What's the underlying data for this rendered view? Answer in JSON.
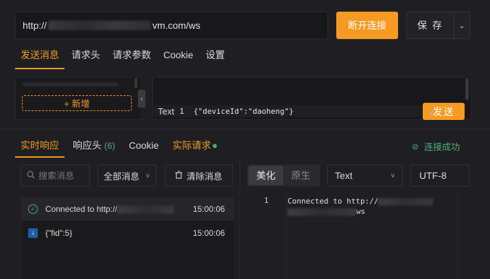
{
  "request": {
    "url_prefix": "http://",
    "url_suffix": "vm.com/ws",
    "disconnect_label": "断开连接",
    "save_label": "保 存",
    "save_dropdown_icon": "chevron-down-icon",
    "tabs": [
      {
        "label": "发送消息",
        "active": true
      },
      {
        "label": "请求头",
        "active": false
      },
      {
        "label": "请求参数",
        "active": false
      },
      {
        "label": "Cookie",
        "active": false
      },
      {
        "label": "设置",
        "active": false
      }
    ],
    "new_button_label": "+ 新增",
    "collapse_icon": "‹",
    "editor": {
      "format": "Text",
      "line_number": "1",
      "content": "{\"deviceId\":\"daoheng\"}"
    },
    "send_label": "发送"
  },
  "response": {
    "tabs": [
      {
        "label": "实时响应",
        "active": true
      },
      {
        "label": "响应头",
        "count": "(6)"
      },
      {
        "label": "Cookie"
      },
      {
        "label": "实际请求"
      }
    ],
    "status_text": "连接成功",
    "search_placeholder": "搜索消息",
    "filter_selected": "全部消息",
    "clear_label": "清除消息",
    "messages": [
      {
        "prefix": "Connected to http://",
        "suffix": "vm.com/ws",
        "time": "15:00:06",
        "kind": "connected"
      },
      {
        "text": "{\"fid\":5}",
        "time": "15:00:06",
        "kind": "received"
      }
    ],
    "view_modes": [
      "美化",
      "原生"
    ],
    "view_mode_selected": "美化",
    "format_selected": "Text",
    "encoding_selected": "UTF-8",
    "viewer": {
      "line_number": "1",
      "line1_prefix": "Connected to http://",
      "line2_suffix": "ws"
    }
  },
  "colors": {
    "accent": "#f59a23",
    "success": "#4caf7d",
    "background": "#1f1f23"
  }
}
